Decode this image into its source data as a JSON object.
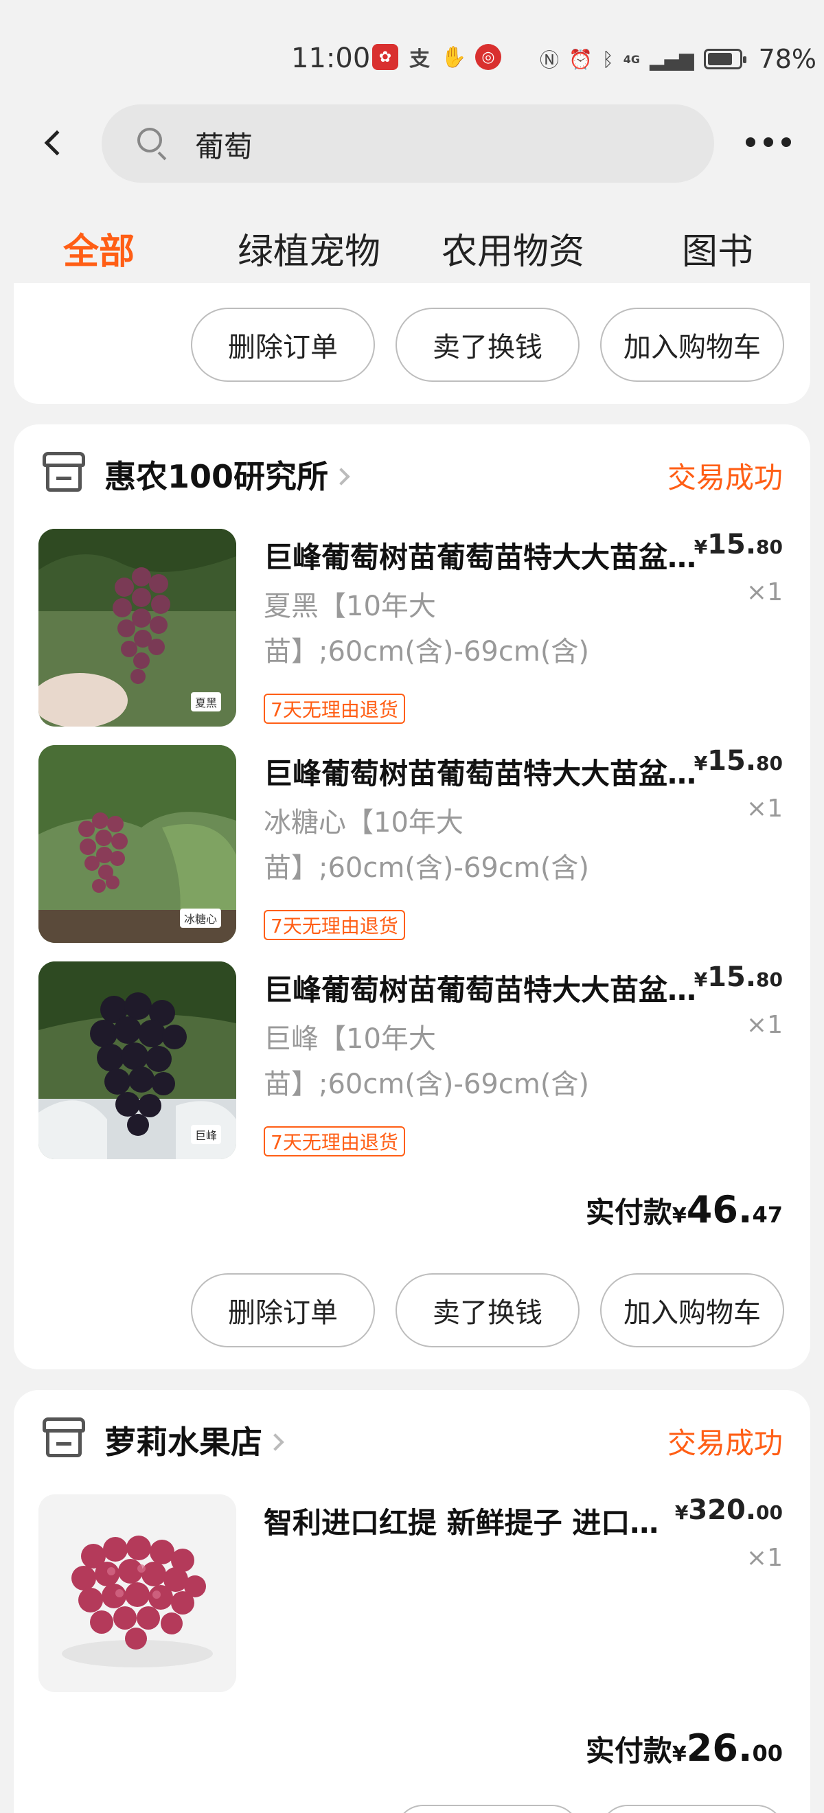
{
  "status_bar": {
    "time": "11:00",
    "battery": "78%",
    "network": "4G"
  },
  "search": {
    "query": "葡萄"
  },
  "tabs": [
    {
      "label": "全部",
      "active": true
    },
    {
      "label": "绿植宠物",
      "active": false
    },
    {
      "label": "农用物资",
      "active": false
    },
    {
      "label": "图书",
      "active": false
    }
  ],
  "prev_order_actions": {
    "delete": "删除订单",
    "resell": "卖了换钱",
    "add_cart": "加入购物车"
  },
  "orders": [
    {
      "store": "惠农100研究所",
      "status": "交易成功",
      "items": [
        {
          "title": "巨峰葡萄树苗葡萄苗特大大苗盆栽地栽",
          "spec": "夏黑【10年大苗】;60cm(含)-69cm(含)",
          "tag": "7天无理由退货",
          "thumb_label": "夏黑",
          "price_cur": "¥",
          "price_int": "15.",
          "price_dec": "80",
          "qty": "×1"
        },
        {
          "title": "巨峰葡萄树苗葡萄苗特大大苗盆栽地栽",
          "spec": "冰糖心【10年大苗】;60cm(含)-69cm(含)",
          "tag": "7天无理由退货",
          "thumb_label": "冰糖心",
          "price_cur": "¥",
          "price_int": "15.",
          "price_dec": "80",
          "qty": "×1"
        },
        {
          "title": "巨峰葡萄树苗葡萄苗特大大苗盆栽地栽",
          "spec": "巨峰【10年大苗】;60cm(含)-69cm(含)",
          "tag": "7天无理由退货",
          "thumb_label": "巨峰",
          "price_cur": "¥",
          "price_int": "15.",
          "price_dec": "80",
          "qty": "×1"
        }
      ],
      "total_label": "实付款",
      "total_cur": "¥",
      "total_int": "46.",
      "total_dec": "47",
      "actions": {
        "delete": "删除订单",
        "resell": "卖了换钱",
        "add_cart": "加入购物车"
      }
    },
    {
      "store": "萝莉水果店",
      "status": "交易成功",
      "items": [
        {
          "title": "智利进口红提 新鲜提子 进口水果",
          "price_cur": "¥",
          "price_int": "320.",
          "price_dec": "00",
          "qty": "×1"
        }
      ],
      "total_label": "实付款",
      "total_cur": "¥",
      "total_int": "26.",
      "total_dec": "00"
    }
  ],
  "colors": {
    "accent": "#ff5e15",
    "background": "#f2f2f2",
    "card": "#ffffff"
  }
}
